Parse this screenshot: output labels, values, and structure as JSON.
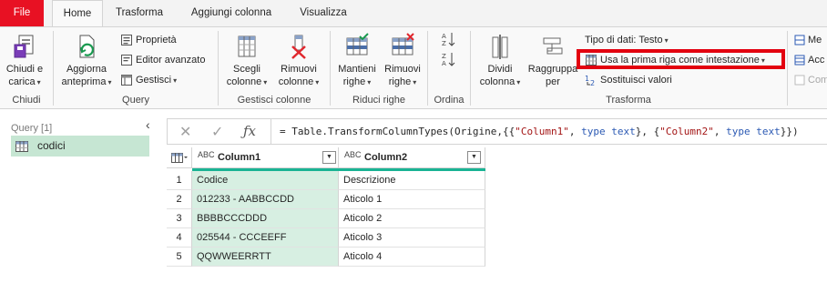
{
  "tabs": [
    {
      "label": "File"
    },
    {
      "label": "Home"
    },
    {
      "label": "Trasforma"
    },
    {
      "label": "Aggiungi colonna"
    },
    {
      "label": "Visualizza"
    }
  ],
  "ribbon": {
    "chiudi": {
      "label1": "Chiudi e",
      "label2": "carica"
    },
    "aggiorna": {
      "label1": "Aggiorna",
      "label2": "anteprima"
    },
    "proprieta": "Proprietà",
    "editor": "Editor avanzato",
    "gestisci": "Gestisci",
    "scegli": {
      "label1": "Scegli",
      "label2": "colonne"
    },
    "rimuovi_col": {
      "label1": "Rimuovi",
      "label2": "colonne"
    },
    "mantieni": {
      "label1": "Mantieni",
      "label2": "righe"
    },
    "rimuovi_righe": {
      "label1": "Rimuovi",
      "label2": "righe"
    },
    "dividi": {
      "label1": "Dividi",
      "label2": "colonna"
    },
    "raggruppa": {
      "label1": "Raggruppa",
      "label2": "per"
    },
    "tipo_dati": "Tipo di dati: Testo",
    "usa_prima_riga": "Usa la prima riga come intestazione",
    "sostituisci": "Sostituisci valori",
    "me": "Me",
    "acc": "Acc",
    "com": "Com",
    "groups": {
      "chiudi": "Chiudi",
      "query": "Query",
      "gestisci_colonne": "Gestisci colonne",
      "riduci_righe": "Riduci righe",
      "ordina": "Ordina",
      "trasforma": "Trasforma"
    }
  },
  "queries_pane": {
    "header": "Query [1]",
    "items": [
      {
        "label": "codici"
      }
    ]
  },
  "formula_bar": {
    "prefix": "= Table.TransformColumnTypes(Origine,{{",
    "s1": "\"Column1\"",
    "mid1": ", ",
    "k1": "type text",
    "mid2": "}, {",
    "s2": "\"Column2\"",
    "mid3": ", ",
    "k2": "type text",
    "suffix": "}})"
  },
  "table": {
    "columns": [
      {
        "type_label": "ABC",
        "name": "Column1"
      },
      {
        "type_label": "ABC",
        "name": "Column2"
      }
    ],
    "rows": [
      {
        "n": "1",
        "c1": "Codice",
        "c2": "Descrizione"
      },
      {
        "n": "2",
        "c1": "012233 - AABBCCDD",
        "c2": "Aticolo 1"
      },
      {
        "n": "3",
        "c1": "BBBBCCCDDD",
        "c2": "Aticolo 2"
      },
      {
        "n": "4",
        "c1": "025544 - CCCEEFF",
        "c2": "Aticolo 3"
      },
      {
        "n": "5",
        "c1": "QQWWEERRTT",
        "c2": "Aticolo 4"
      }
    ]
  },
  "colors": {
    "accent": "#1ab394",
    "file_tab": "#e81123",
    "highlight": "#e3000f",
    "selected_query": "#c6e6d3"
  }
}
